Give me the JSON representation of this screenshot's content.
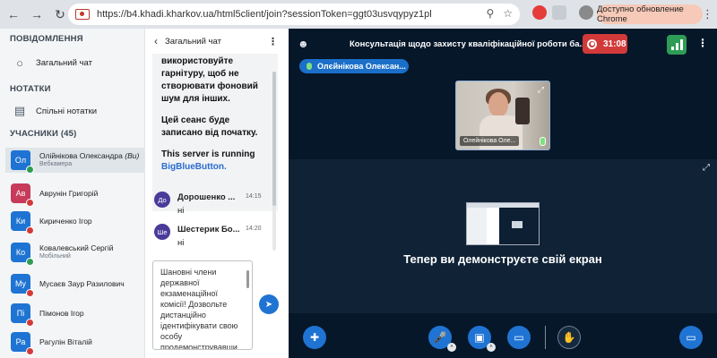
{
  "browser": {
    "url": "https://b4.khadi.kharkov.ua/html5client/join?sessionToken=ggt03usvqypyz1pl",
    "update_label": "Доступно обновление Chrome",
    "back_icon": "arrow-left-icon",
    "forward_icon": "arrow-right-icon",
    "reload_icon": "reload-icon"
  },
  "sidebar": {
    "messages_title": "ПОВІДОМЛЕННЯ",
    "public_chat_label": "Загальний чат",
    "notes_title": "НОТАТКИ",
    "shared_notes_label": "Спільні нотатки",
    "users_title": "УЧАСНИКИ (45)",
    "users": [
      {
        "initials": "Ол",
        "name": "Олійнікова Олександра",
        "suffix": "(Ви)",
        "sub": "Вебкамера",
        "color": "#1f74d3"
      },
      {
        "initials": "Ав",
        "name": "Аврунін Григорій",
        "sub": "",
        "color": "#c73a5a"
      },
      {
        "initials": "Ки",
        "name": "Кириченко Ігор",
        "sub": "",
        "color": "#1f74d3"
      },
      {
        "initials": "Ко",
        "name": "Ковалевський Сергій",
        "sub": "Мобільний",
        "color": "#1f74d3"
      },
      {
        "initials": "Му",
        "name": "Мусаєв Заур Разилович",
        "sub": "",
        "color": "#1f74d3"
      },
      {
        "initials": "Пі",
        "name": "Пімонов Ігор",
        "sub": "",
        "color": "#1f74d3"
      },
      {
        "initials": "Ра",
        "name": "Рагулін Віталій",
        "sub": "",
        "color": "#1f74d3"
      }
    ]
  },
  "chat": {
    "title": "Загальний чат",
    "welcome_1": "використовуйте гарнітуру, щоб не створювати фоновий шум для інших.",
    "welcome_2": "Цей сеанс буде записано від початку.",
    "welcome_3": "This server is running",
    "welcome_link": "BigBlueButton.",
    "messages": [
      {
        "initials": "До",
        "name": "Дорошенко ...",
        "time": "14:15",
        "text": "ні"
      },
      {
        "initials": "Ше",
        "name": "Шестерик Бо...",
        "time": "14:20",
        "text": "ні"
      }
    ],
    "composer_text": "Шановні члени державної екзаменаційної комісії! Дозвольте дистанційно ідентифікувати свою особу продемонструвавши"
  },
  "meeting": {
    "title": "Консультація щодо захисту кваліфікаційної роботи ба...",
    "timer": "31:08",
    "talker": "Олєйнікова Олексан...",
    "video_label": "Олейнікова Оле...",
    "screen_message": "Тепер ви демонструєте свій екран"
  },
  "colors": {
    "accent": "#1f74d3",
    "record": "#d23a3a",
    "connection": "#2e9c55",
    "main_bg": "#06172a"
  }
}
